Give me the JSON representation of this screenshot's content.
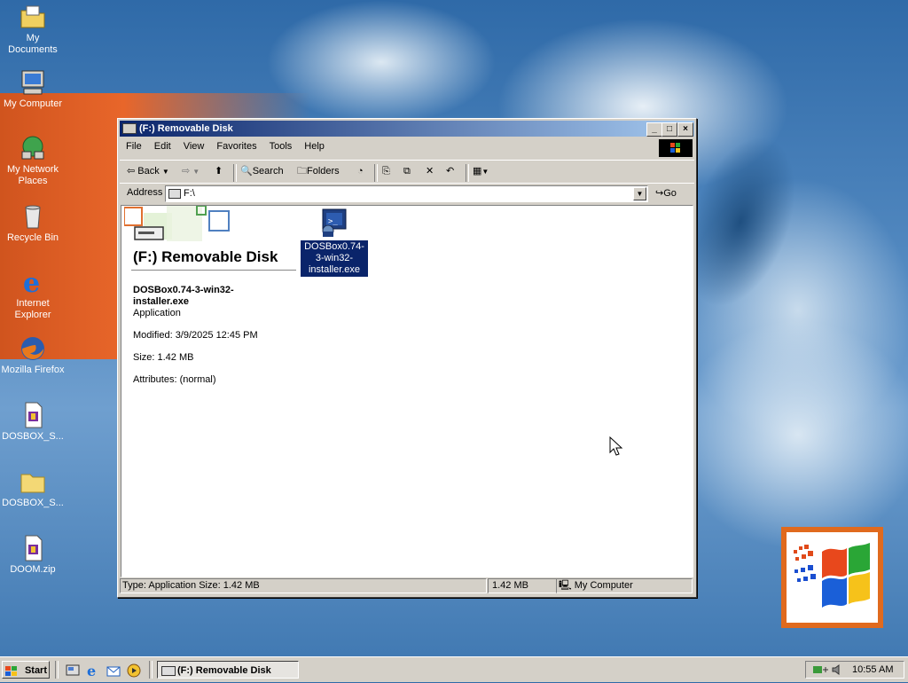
{
  "desktop": {
    "icons": [
      {
        "label": "My Documents"
      },
      {
        "label": "My Computer"
      },
      {
        "label": "My Network Places"
      },
      {
        "label": "Recycle Bin"
      },
      {
        "label": "Internet Explorer"
      },
      {
        "label": "Mozilla Firefox"
      },
      {
        "label": "DOSBOX_S..."
      },
      {
        "label": "DOSBOX_S..."
      },
      {
        "label": "DOOM.zip"
      }
    ]
  },
  "window": {
    "title": "(F:) Removable Disk",
    "menu": [
      "File",
      "Edit",
      "View",
      "Favorites",
      "Tools",
      "Help"
    ],
    "toolbar": {
      "back": "Back",
      "search": "Search",
      "folders": "Folders"
    },
    "address": {
      "label": "Address",
      "value": "F:\\",
      "go": "Go"
    },
    "banner_title": "(F:) Removable Disk",
    "selected": {
      "name": "DOSBox0.74-3-win32-installer.exe",
      "type": "Application",
      "modified": "Modified: 3/9/2025 12:45 PM",
      "size": "Size: 1.42 MB",
      "attributes": "Attributes: (normal)"
    },
    "file_icon_label": "DOSBox0.74-3-win32-installer.exe",
    "status": {
      "left": "Type: Application Size: 1.42 MB",
      "mid": "1.42 MB",
      "right": "My Computer"
    }
  },
  "taskbar": {
    "start": "Start",
    "task": "(F:) Removable Disk",
    "clock": "10:55 AM"
  },
  "colors": {
    "titlebar_start": "#0a246a",
    "titlebar_end": "#a6caf0",
    "selection": "#0a246a",
    "desktop": "#3d76b0"
  }
}
